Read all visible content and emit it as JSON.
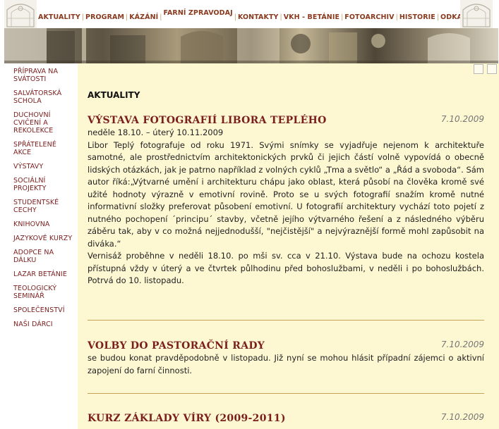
{
  "nav": {
    "items": [
      {
        "label": "AKTUALITY"
      },
      {
        "label": "PROGRAM"
      },
      {
        "label": "KÁZÁNÍ"
      },
      {
        "label": "FARNÍ ZPRAVODAJ"
      },
      {
        "label": "KONTAKTY"
      },
      {
        "label": "VKH - BETÁNIE"
      },
      {
        "label": "FOTOARCHIV"
      },
      {
        "label": "HISTORIE"
      },
      {
        "label": "ODKAZY"
      }
    ]
  },
  "sidebar": {
    "items": [
      {
        "label": "PŘÍPRAVA NA SVÁTOSTI"
      },
      {
        "label": "SALVÁTORSKÁ SCHOLA"
      },
      {
        "label": "DUCHOVNÍ CVIČENÍ A REKOLEKCE"
      },
      {
        "label": "SPŘÁTELENÉ AKCE"
      },
      {
        "label": "VÝSTAVY"
      },
      {
        "label": "SOCIÁLNÍ PROJEKTY"
      },
      {
        "label": "STUDENTSKÉ CECHY"
      },
      {
        "label": "KNIHOVNA"
      },
      {
        "label": "JAZYKOVÉ KURZY"
      },
      {
        "label": "ADOPCE NA DÁLKU"
      },
      {
        "label": "LAZAR BETÁNIE"
      },
      {
        "label": "TEOLOGICKÝ SEMINÁŘ"
      },
      {
        "label": "SPOLEČENSTVÍ"
      },
      {
        "label": "NAŠI DÁRCI"
      }
    ]
  },
  "main": {
    "section_title": "AKTUALITY",
    "articles": [
      {
        "title": "VÝSTAVA FOTOGRAFIÍ LIBORA TEPLÉHO",
        "date": "7.10.2009",
        "paragraphs": [
          "neděle 18.10. – úterý 10.11.2009",
          "Libor Teplý fotografuje od roku 1971. Svými snímky se vyjadřuje nejenom k architektuře samotné, ale prostřednictvím architektonických prvků či jejich částí volně vypovídá o obecně lidských otázkách, jak je patrno například z volných cyklů „Tma a světlo“ a „Řád a svoboda“. Sám autor říká:„Výtvarné umění i architekturu chápu jako oblast, která působí na člověka kromě své užité hodnoty výrazně v emotivní rovině. Proto se u svých fotografií snažím kromě nutné informativní složky preferovat působení emotivní. U fotografií architektury vychází toto pojetí z nutného pochopení ´principu´ stavby, včetně jejího výtvarného řešení a z následného výběru záběru tak, aby v co možná nejjednodušší, \"nejčistější\" a nejvýraznější formě mohl zapůsobit na diváka.“",
          "Vernisáž proběhne v neděli 18.10. po mši sv. cca v 21.10. Výstava bude na ochozu kostela přístupná vždy v úterý a ve čtvrtek půlhodinu před bohoslužbami, v neděli i po bohoslužbách. Potrvá do 10. listopadu."
        ]
      },
      {
        "title": "VOLBY DO PASTORAČNÍ RADY",
        "date": "7.10.2009",
        "paragraphs": [
          "se budou konat pravděpodobně v listopadu. Již nyní se mohou hlásit případní zájemci o aktivní zapojení do farní činnosti."
        ]
      },
      {
        "title": "KURZ ZÁKLADY VÍRY (2009-2011)",
        "date": "7.10.2009",
        "paragraphs": []
      }
    ]
  }
}
